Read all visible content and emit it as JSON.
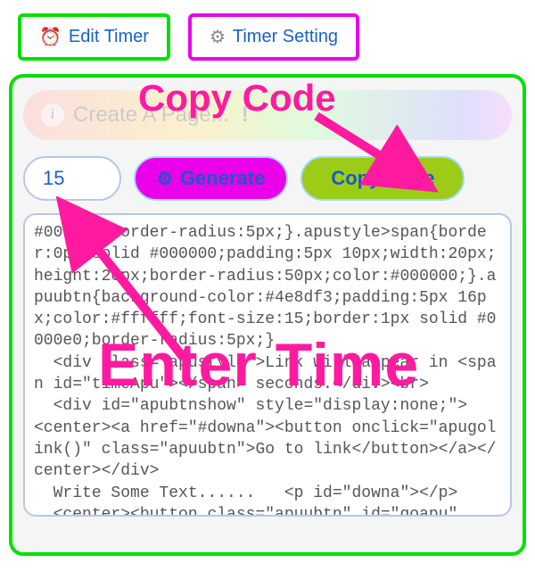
{
  "top": {
    "edit_timer_label": "Edit Timer",
    "timer_setting_label": "Timer Setting",
    "clock_glyph": "⏰",
    "gear_glyph": "⚙"
  },
  "banner": {
    "info_glyph": "i",
    "text": "Create A Page...",
    "bang": "!"
  },
  "controls": {
    "time_value": "15",
    "gear_glyph": "⚙",
    "generate_label": "Generate",
    "copy_label": "Copy Code"
  },
  "code_text": "#000000;border-radius:5px;}.apustyle>span{border:0px solid #000000;padding:5px 10px;width:20px;height:20px;border-radius:50px;color:#000000;}.apuubtn{background-color:#4e8df3;padding:5px 16px;color:#ffffff;font-size:15;border:1px solid #0000e0;border-radius:5px;}\n  <div class=\"apustyle\">Link will appear in <span id=\"timeApu\"></span> seconds.</div><br>\n  <div id=\"apubtnshow\" style=\"display:none;\">\n<center><a href=\"#downa\"><button onclick=\"apugolink()\" class=\"apuubtn\">Go to link</button></a></center></div>\n  Write Some Text......   <p id=\"downa\"></p>\n  <center><button class=\"apuubtn\" id=\"goapu\"",
  "annotations": {
    "copy_code": "Copy Code",
    "enter_time": "Enter Time"
  }
}
